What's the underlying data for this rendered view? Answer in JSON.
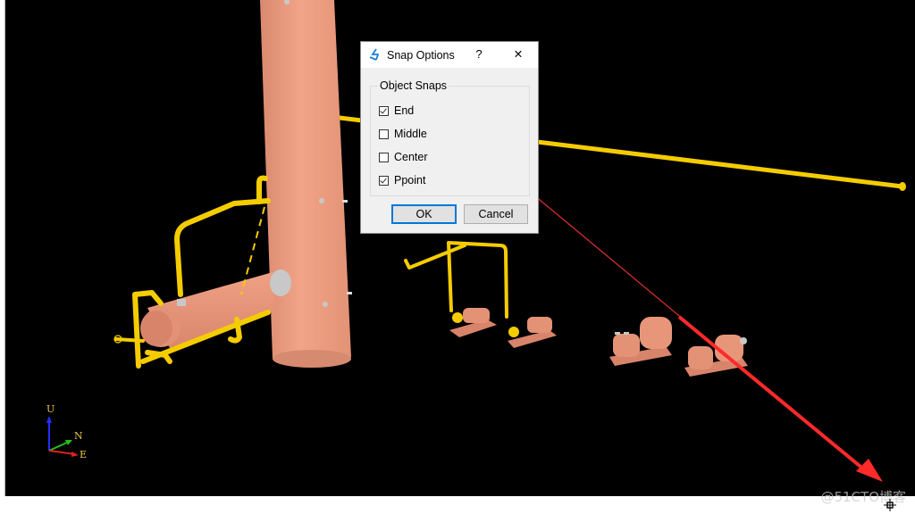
{
  "viewport": {
    "background": "#000000",
    "colors": {
      "equipment": "#e8967a",
      "piping": "#ffd700",
      "nozzle": "#c8c8c8",
      "annotation_arrow": "#ff3030"
    },
    "orientation_triad": {
      "up_label": "U",
      "north_label": "N",
      "east_label": "E"
    }
  },
  "dialog": {
    "title": "Snap Options",
    "help_label": "?",
    "close_label": "✕",
    "app_icon": "snap-app-icon",
    "group_label": "Object Snaps",
    "options": [
      {
        "label": "End",
        "checked": true
      },
      {
        "label": "Middle",
        "checked": false
      },
      {
        "label": "Center",
        "checked": false
      },
      {
        "label": "Ppoint",
        "checked": true
      }
    ],
    "ok_label": "OK",
    "cancel_label": "Cancel"
  },
  "watermark": "@51CTO博客",
  "status": {
    "snap_cursor_icon": "snap-crosshair-icon"
  }
}
